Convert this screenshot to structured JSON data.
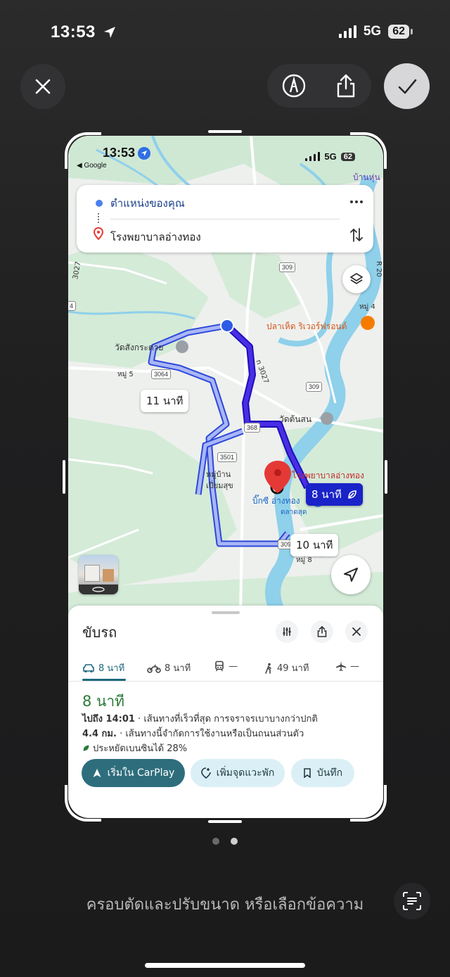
{
  "status_bar": {
    "time": "13:53",
    "network": "5G",
    "battery": "62"
  },
  "toolbar": {
    "close_icon": "close-icon",
    "markup_icon": "markup-pen-icon",
    "share_icon": "share-icon",
    "done_icon": "checkmark-icon"
  },
  "screenshot": {
    "status_bar": {
      "time": "13:53",
      "back_label": "◀ Google",
      "network": "5G",
      "battery": "62"
    },
    "route": {
      "origin": "ตำแหน่งของคุณ",
      "destination": "โรงพยาบาลอ่างทอง"
    },
    "map_labels": {
      "area_top_right": "บ้านหุ่น",
      "temple_1": "วัดสังกระตาย",
      "moo5": "หมู่ 5",
      "restaurant": "ปลาเห็ด ริเวอร์ฟรอนต์",
      "moo4": "หมู่ 4",
      "temple_2": "วัดต้นสน",
      "hospital": "โรงพยาบาลอ่างทอง",
      "village_1": "หมู่บ้าน",
      "village_2": "เปี่ยมสุข",
      "bigc": "บิ๊กซี อ่างทอง",
      "talat": "ตลาดสุด",
      "moo8": "หมู่ 8",
      "road_3027": "3027",
      "road_n3027": "n 3027",
      "road_rot": "R 20"
    },
    "road_badges": [
      "309",
      "3064",
      "309",
      "368",
      "3501",
      "309",
      "4"
    ],
    "time_bubbles": {
      "alt1": "11 นาที",
      "selected": "8 นาที",
      "alt2": "10 นาที"
    },
    "sheet": {
      "title": "ขับรถ",
      "tabs": [
        {
          "mode": "car",
          "label": "8 นาที"
        },
        {
          "mode": "motorcycle",
          "label": "8 นาที"
        },
        {
          "mode": "transit",
          "label": "—"
        },
        {
          "mode": "walk",
          "label": "49 นาที"
        },
        {
          "mode": "flight",
          "label": "—"
        }
      ],
      "duration": "8 นาที",
      "arrive_label": "ไปถึง 14:01",
      "arrive_detail": " · เส้นทางที่เร็วที่สุด การจราจรเบาบางกว่าปกติ",
      "distance_label": "4.4 กม.",
      "distance_detail": " · เส้นทางนี้จำกัดการใช้งานหรือเป็นถนนส่วนตัว",
      "fuel_saving": "ประหยัดเบนซินได้ 28%",
      "buttons": {
        "start": "เริ่มใน CarPlay",
        "add_stop": "เพิ่มจุดแวะพัก",
        "save": "บันทึก"
      }
    }
  },
  "pager": {
    "count": 2,
    "active": 2
  },
  "caption": "ครอบตัดและปรับขนาด หรือเลือกข้อความ"
}
